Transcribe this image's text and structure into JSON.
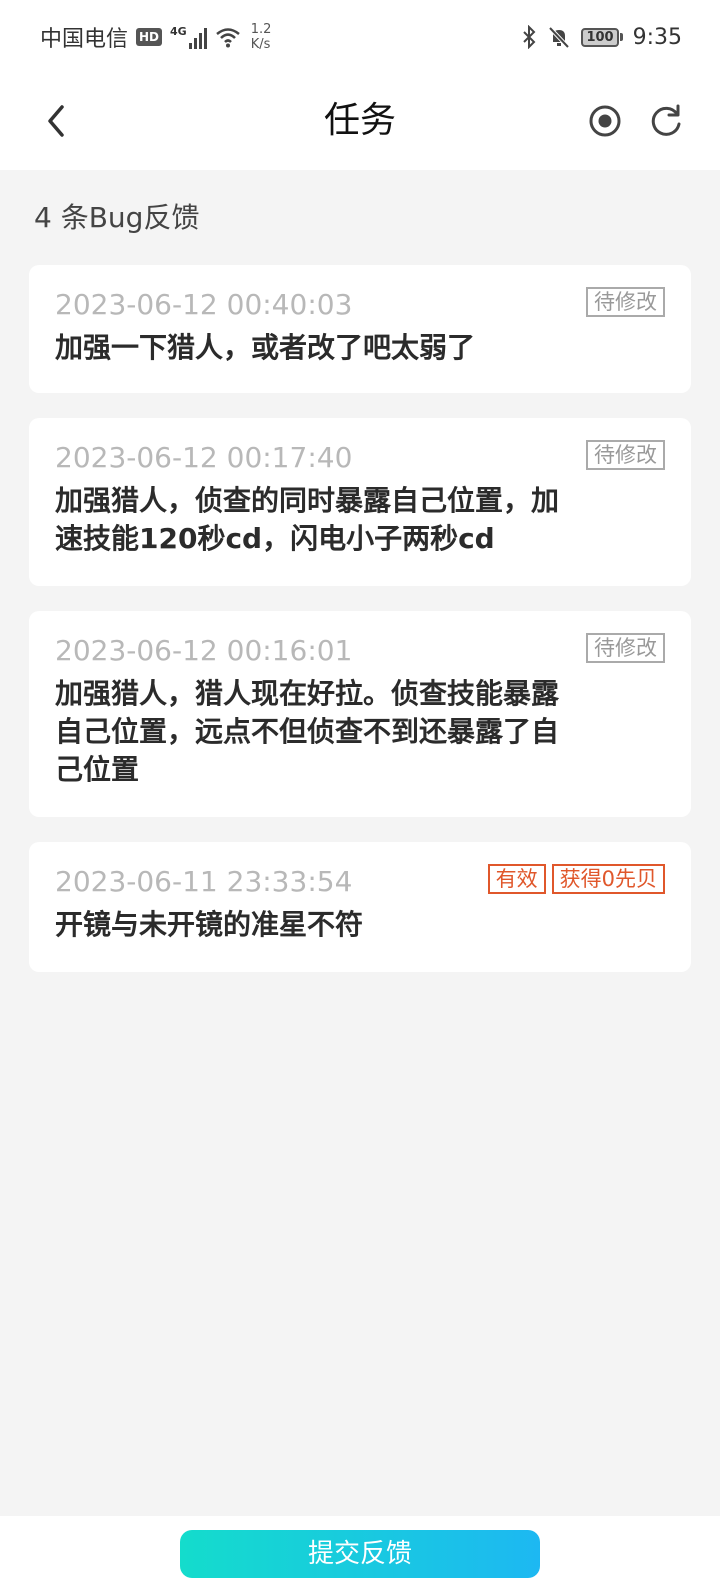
{
  "status_bar": {
    "carrier": "中国电信",
    "hd": "HD",
    "network": "4G",
    "speed_value": "1.2",
    "speed_unit": "K/s",
    "battery": "100",
    "time": "9:35"
  },
  "header": {
    "title": "任务",
    "back_icon": "chevron-left-icon",
    "record_icon": "record-icon",
    "refresh_icon": "refresh-icon"
  },
  "summary": {
    "count_text": "4 条Bug反馈"
  },
  "feedback_list": [
    {
      "timestamp": "2023-06-12 00:40:03",
      "content": "加强一下猎人，或者改了吧太弱了",
      "tags": [
        {
          "label": "待修改",
          "color": "#999999"
        }
      ]
    },
    {
      "timestamp": "2023-06-12 00:17:40",
      "content": "加强猎人，侦查的同时暴露自己位置，加速技能120秒cd，闪电小子两秒cd",
      "tags": [
        {
          "label": "待修改",
          "color": "#999999"
        }
      ]
    },
    {
      "timestamp": "2023-06-12 00:16:01",
      "content": "加强猎人，猎人现在好拉。侦查技能暴露自己位置，远点不但侦查不到还暴露了自己位置",
      "tags": [
        {
          "label": "待修改",
          "color": "#999999"
        }
      ]
    },
    {
      "timestamp": "2023-06-11 23:33:54",
      "content": "开镜与未开镜的准星不符",
      "tags": [
        {
          "label": "有效",
          "color": "#e0572b"
        },
        {
          "label": "获得0先贝",
          "color": "#e0572b"
        }
      ]
    }
  ],
  "footer": {
    "submit_label": "提交反馈"
  },
  "colors": {
    "accent_start": "#14dccc",
    "accent_end": "#1db8f2",
    "tag_orange": "#e0572b",
    "background": "#f4f4f4"
  }
}
